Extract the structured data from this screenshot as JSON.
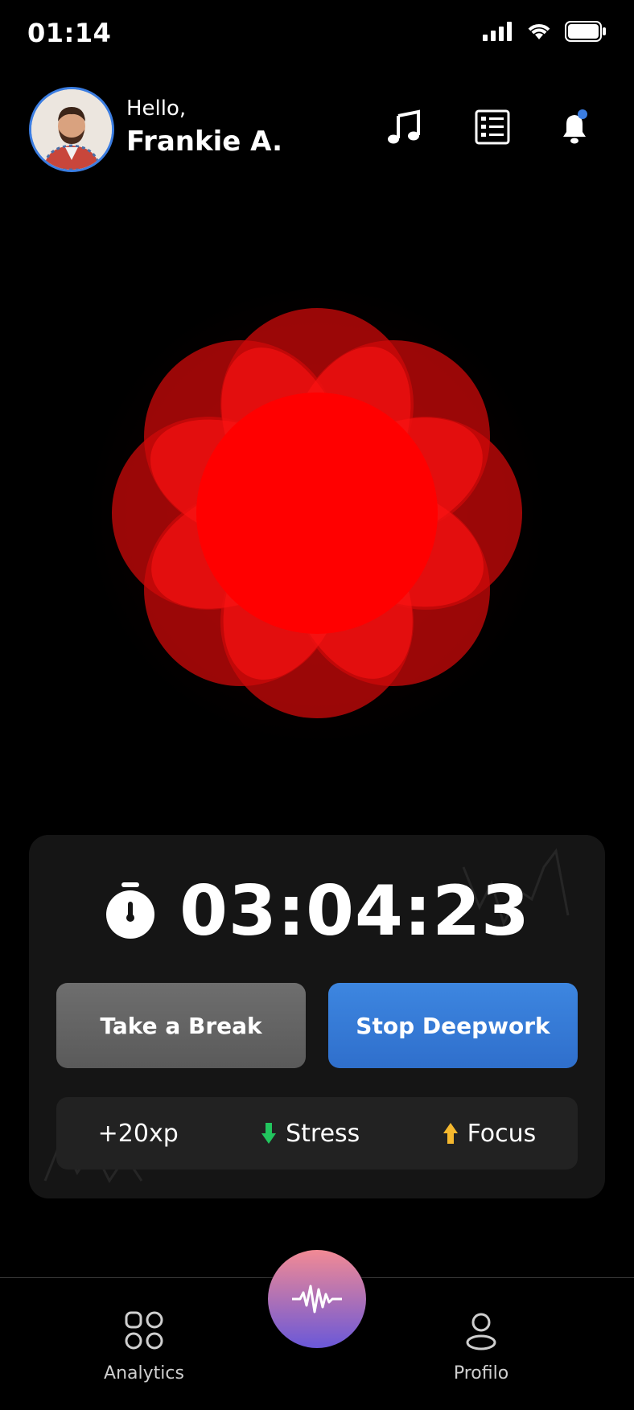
{
  "status_bar": {
    "time": "01:14"
  },
  "header": {
    "greeting": "Hello,",
    "user_name": "Frankie A."
  },
  "session": {
    "timer": "03:04:23",
    "break_button": "Take a Break",
    "stop_button": "Stop Deepwork",
    "stats": {
      "xp": "+20xp",
      "stress": "Stress",
      "focus": "Focus"
    }
  },
  "nav": {
    "analytics": "Analytics",
    "profile": "Profilo"
  },
  "colors": {
    "accent_blue": "#3b7de1",
    "flower_red": "#ff0000",
    "stress_green": "#22c55e",
    "focus_yellow": "#f5b82e"
  },
  "icons": [
    "signal-icon",
    "wifi-icon",
    "battery-icon",
    "music-note-icon",
    "list-icon",
    "bell-icon",
    "stopwatch-icon",
    "arrow-down-icon",
    "arrow-up-icon",
    "analytics-grid-icon",
    "waveform-icon",
    "profile-icon"
  ]
}
